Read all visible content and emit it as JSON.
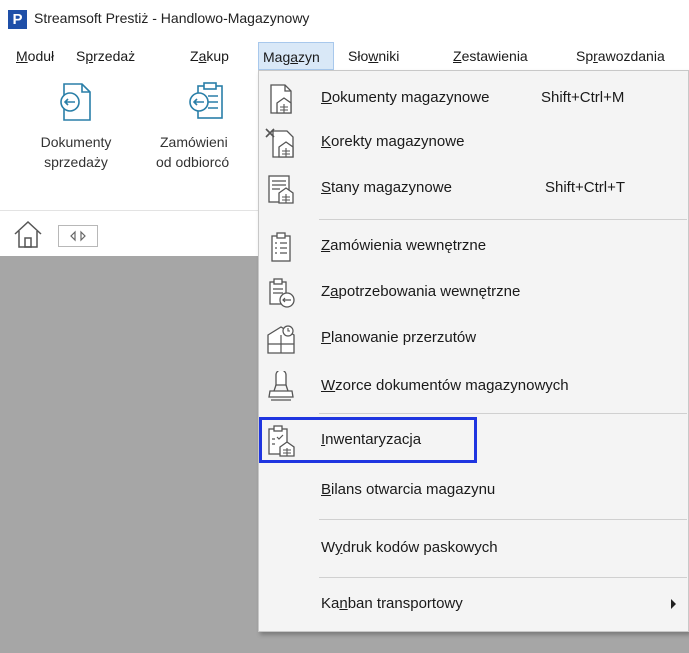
{
  "window": {
    "title": "Streamsoft Prestiż - Handlowo-Magazynowy",
    "logo_letter": "P"
  },
  "menubar": {
    "items": [
      {
        "label": "Moduł",
        "ul": "M",
        "rest": "oduł"
      },
      {
        "label": "Sprzedaż",
        "pre": "S",
        "ul": "p",
        "rest": "rzedaż"
      },
      {
        "label": "Zakup",
        "pre": "Z",
        "ul": "a",
        "rest": "kup"
      },
      {
        "label": "Magazyn",
        "pre": "Mag",
        "ul": "a",
        "rest": "zyn"
      },
      {
        "label": "Słowniki",
        "pre": "Sło",
        "ul": "w",
        "rest": "niki"
      },
      {
        "label": "Zestawienia",
        "ul": "Z",
        "rest": "estawienia"
      },
      {
        "label": "Sprawozdania",
        "pre": "Sp",
        "ul": "r",
        "rest": "awozdania"
      }
    ]
  },
  "ribbon": {
    "buttons": [
      {
        "line1": "Dokumenty",
        "line2": "sprzedaży",
        "icon": "document-arrow-icon"
      },
      {
        "line1": "Zamówieni",
        "line2": "od odbiorcó",
        "icon": "order-list-arrow-icon"
      }
    ]
  },
  "dropdown": {
    "items": [
      {
        "ul": "D",
        "rest": "okumenty magazynowe",
        "shortcut": "Shift+Ctrl+M",
        "icon": "warehouse-document-icon"
      },
      {
        "ul": "K",
        "rest": "orekty magazynowe",
        "shortcut": "",
        "icon": "warehouse-correction-icon"
      },
      {
        "ul": "S",
        "rest": "tany magazynowe",
        "shortcut": "Shift+Ctrl+T",
        "icon": "warehouse-stock-icon"
      },
      {
        "ul": "Z",
        "rest": "amówienia wewnętrzne",
        "shortcut": "",
        "icon": "internal-order-icon"
      },
      {
        "pre": "Z",
        "ul": "a",
        "rest": "potrzebowania wewnętrzne",
        "shortcut": "",
        "icon": "internal-demand-icon"
      },
      {
        "ul": "P",
        "rest": "lanowanie przerzutów",
        "shortcut": "",
        "icon": "transfer-planning-icon"
      },
      {
        "ul": "W",
        "rest": "zorce dokumentów magazynowych",
        "shortcut": "",
        "icon": "document-stamp-icon"
      },
      {
        "ul": "I",
        "rest": "nwentaryzacja",
        "shortcut": "",
        "icon": "inventory-icon"
      },
      {
        "ul": "B",
        "rest": "ilans otwarcia magazynu",
        "shortcut": "",
        "icon": ""
      },
      {
        "pre": "W",
        "ul": "y",
        "rest": "druk kodów paskowych",
        "shortcut": "",
        "icon": ""
      },
      {
        "pre": "Ka",
        "ul": "n",
        "rest": "ban transportowy",
        "shortcut": "",
        "icon": "",
        "submenu": true
      }
    ]
  },
  "colors": {
    "highlight": "#1f35e0",
    "active_menu": "#d9e8f7",
    "workspace": "#a6a6a6",
    "logo": "#1e4fa8"
  }
}
